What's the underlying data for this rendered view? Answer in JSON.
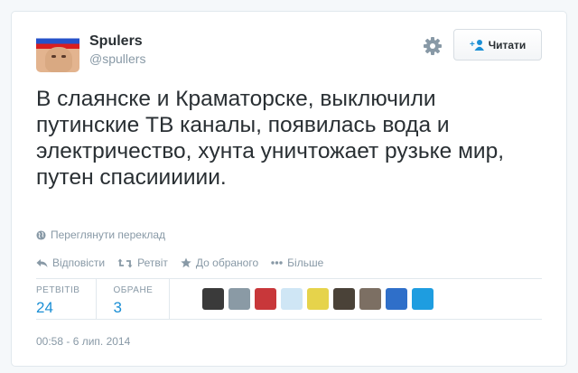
{
  "user": {
    "name": "Spulers",
    "handle": "@spullers"
  },
  "follow_button": {
    "label": "Читати"
  },
  "tweet": {
    "text": "В слаянске и Краматорске, выключили путинские ТВ каналы, появилась вода и электричество, хунта уничтожает рузьке мир, путен спасииииии."
  },
  "translate_link": "Переглянути переклад",
  "actions": [
    {
      "icon": "reply-icon",
      "label": "Відповісти"
    },
    {
      "icon": "retweet-icon",
      "label": "Ретвіт"
    },
    {
      "icon": "star-icon",
      "label": "До обраного"
    },
    {
      "icon": "more-icon",
      "label": "Більше"
    }
  ],
  "stats": {
    "retweets_label": "РЕТВІТІВ",
    "retweets_value": "24",
    "favorites_label": "ОБРАНЕ",
    "favorites_value": "3"
  },
  "favoriters": [
    {
      "color": "#3a3a3a"
    },
    {
      "color": "#8a9aa5"
    },
    {
      "color": "#c8373a"
    },
    {
      "color": "#cfe6f5"
    },
    {
      "color": "#e6d34b"
    },
    {
      "color": "#4a4238"
    },
    {
      "color": "#7c6f63"
    },
    {
      "color": "#2f6fc9"
    },
    {
      "color": "#1e9de0"
    }
  ],
  "timestamp": "00:58 - 6 лип. 2014",
  "colors": {
    "link": "#1b8fd5",
    "muted": "#8899a6",
    "text": "#292f33"
  }
}
